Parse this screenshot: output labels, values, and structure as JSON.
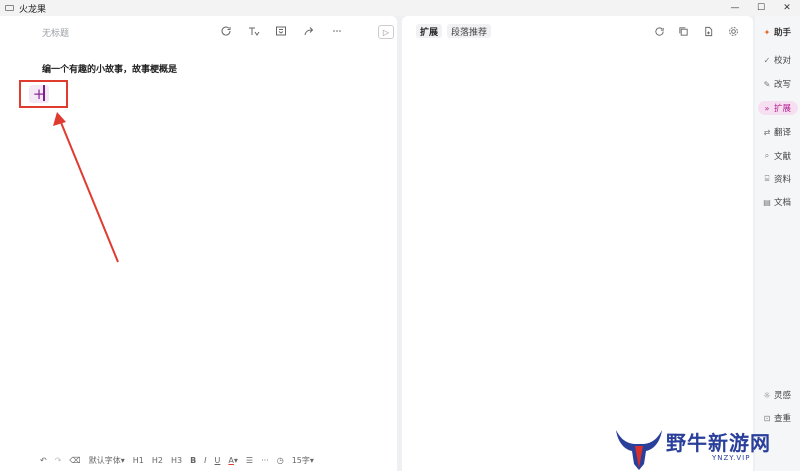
{
  "window": {
    "title": "火龙果",
    "controls": [
      "—",
      "☐",
      "✕"
    ]
  },
  "editor": {
    "doc_title_placeholder": "无标题",
    "prompt_text": "编一个有趣的小故事，故事梗概是",
    "insert_symbol": "+",
    "toolbar": {
      "font_default": "默认字体",
      "h1": "H1",
      "h2": "H2",
      "h3": "H3",
      "bold": "B",
      "italic": "I",
      "underline": "U",
      "font_color": "A",
      "more": "···",
      "word_count": "15字"
    }
  },
  "panel": {
    "tabs": [
      "扩展",
      "段落推荐"
    ]
  },
  "sidebar": {
    "header": "助手",
    "items": [
      {
        "label": "校对",
        "icon": "check-icon"
      },
      {
        "label": "改写",
        "icon": "rewrite-icon"
      },
      {
        "label": "扩展",
        "icon": "expand-icon",
        "active": true
      },
      {
        "label": "翻译",
        "icon": "translate-icon"
      },
      {
        "label": "文献",
        "icon": "search-icon"
      },
      {
        "label": "资料",
        "icon": "folder-icon"
      },
      {
        "label": "文档",
        "icon": "doc-icon"
      }
    ],
    "bottom": [
      {
        "label": "灵感",
        "icon": "bulb-icon"
      },
      {
        "label": "查重",
        "icon": "check-dup-icon"
      }
    ]
  },
  "colors": {
    "accent": "#b01e8c",
    "annotation_red": "#e03b2f"
  },
  "watermark": {
    "text": "野牛新游网",
    "sub": "YNZY.VIP"
  }
}
